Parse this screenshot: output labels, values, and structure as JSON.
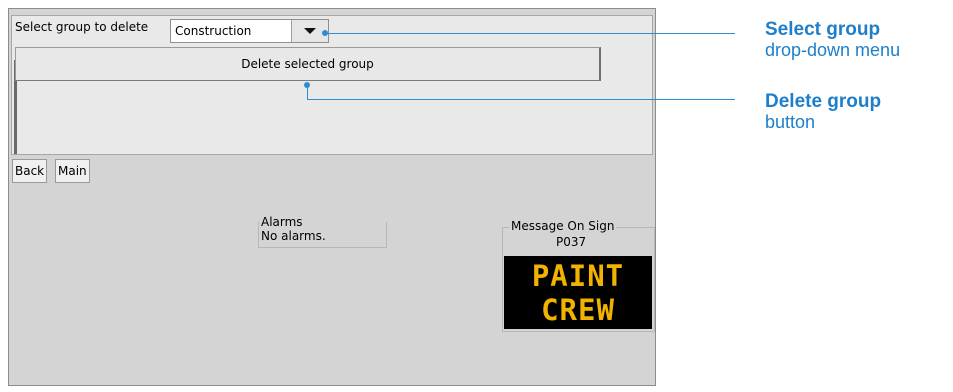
{
  "form": {
    "select_label": "Select group to delete",
    "select_value": "Construction",
    "delete_button": "Delete selected group"
  },
  "nav": {
    "back": "Back",
    "main": "Main"
  },
  "alarms": {
    "title": "Alarms",
    "text": "No alarms."
  },
  "sign": {
    "title": "Message On Sign",
    "code": "P037",
    "line1": "PAINT",
    "line2": "CREW",
    "text_color": "#f2b300"
  },
  "annotations": {
    "select": {
      "title": "Select group",
      "subtitle": "drop-down menu"
    },
    "delete": {
      "title": "Delete group",
      "subtitle": "button"
    },
    "color": "#1d7fcb"
  }
}
